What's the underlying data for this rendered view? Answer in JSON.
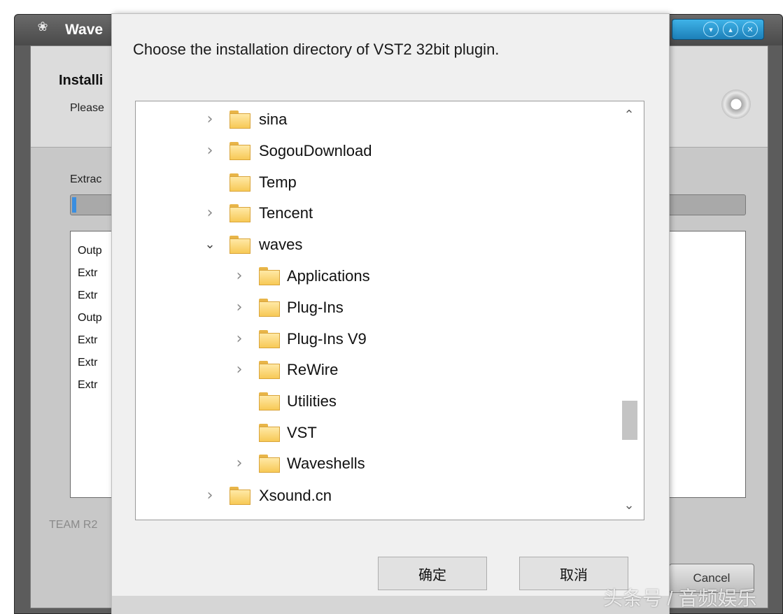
{
  "installer": {
    "title": "Wave",
    "header_title": "Installi",
    "header_subtitle": "Please",
    "extract_label": "Extrac",
    "log_lines": [
      "Outp",
      "Extr",
      "Extr",
      "Outp",
      "Extr",
      "Extr",
      "Extr"
    ],
    "footer": "TEAM R2",
    "cancel_label": "Cancel",
    "progress": 0.005
  },
  "dialog": {
    "prompt": "Choose the installation directory of VST2 32bit plugin.",
    "tree": [
      {
        "name": "sina",
        "level": 0,
        "expander": "collapsed"
      },
      {
        "name": "SogouDownload",
        "level": 0,
        "expander": "collapsed"
      },
      {
        "name": "Temp",
        "level": 0,
        "expander": "none"
      },
      {
        "name": "Tencent",
        "level": 0,
        "expander": "collapsed"
      },
      {
        "name": "waves",
        "level": 0,
        "expander": "expanded"
      },
      {
        "name": "Applications",
        "level": 1,
        "expander": "collapsed"
      },
      {
        "name": "Plug-Ins",
        "level": 1,
        "expander": "collapsed"
      },
      {
        "name": "Plug-Ins V9",
        "level": 1,
        "expander": "collapsed"
      },
      {
        "name": "ReWire",
        "level": 1,
        "expander": "collapsed"
      },
      {
        "name": "Utilities",
        "level": 1,
        "expander": "none"
      },
      {
        "name": "VST",
        "level": 1,
        "expander": "none"
      },
      {
        "name": "Waveshells",
        "level": 1,
        "expander": "collapsed"
      },
      {
        "name": "Xsound.cn",
        "level": 0,
        "expander": "collapsed"
      }
    ],
    "ok_label": "确定",
    "cancel_label": "取消"
  },
  "watermark": "头条号 / 音频娱乐",
  "colors": {
    "dialog_bg": "#f0f0f0",
    "folder": "#f7c956",
    "installer_bg": "#5c5c5c",
    "titlebar_buttons": "#2a9ad4"
  }
}
